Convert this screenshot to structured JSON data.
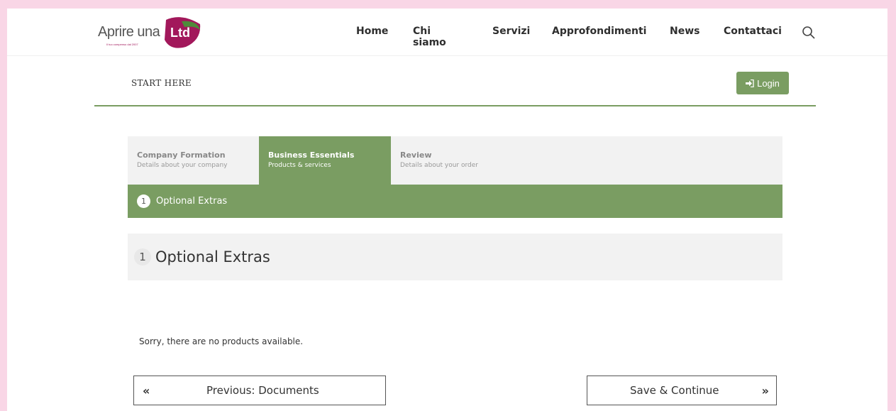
{
  "header": {
    "logo": {
      "text": "Aprire una",
      "badge": "Ltd",
      "tagline": "Il tuo compenso dal 2007"
    },
    "nav": [
      "Home",
      "Chi siamo",
      "Servizi",
      "Approfondimenti",
      "News",
      "Contattaci"
    ],
    "search_icon": "search-icon"
  },
  "start_bar": {
    "label": "START HERE",
    "login_label": "Login",
    "login_icon": "sign-in-icon"
  },
  "steps": [
    {
      "title": "Company Formation",
      "subtitle": "Details about your company",
      "active": false
    },
    {
      "title": "Business Essentials",
      "subtitle": "Products & services",
      "active": true
    },
    {
      "title": "Review",
      "subtitle": "Details about your order",
      "active": false
    }
  ],
  "substep": {
    "number": "1",
    "label": "Optional Extras"
  },
  "panel": {
    "number": "1",
    "title": "Optional Extras"
  },
  "message": "Sorry, there are no products available.",
  "buttons": {
    "prev_label": "Previous: Documents",
    "prev_icon": "«",
    "next_label": "Save & Continue",
    "next_icon": "»"
  },
  "colors": {
    "accent": "#7a9d62",
    "background": "#f9d6e6",
    "brand": "#a2185b"
  }
}
